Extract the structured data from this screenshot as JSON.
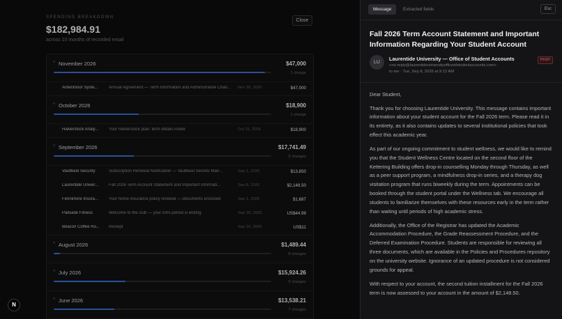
{
  "breakdown": {
    "eyebrow": "SPENDING BREAKDOWN",
    "total": "$182,984.91",
    "subtitle": "across 10 months of recorded email",
    "close_label": "Close",
    "months": [
      {
        "label": "November 2026",
        "amount": "$47,000",
        "count": "1 charge",
        "fill_pct": 97,
        "rows": [
          {
            "vendor": "Ardenmoor Syste...",
            "subject": "Annual Agreement — Term Information and Administrative Chan...",
            "date": "Nov 30, 2026",
            "amount": "$47,000"
          }
        ]
      },
      {
        "label": "October 2026",
        "amount": "$18,900",
        "count": "1 charge",
        "fill_pct": 39,
        "rows": [
          {
            "vendor": "Halverstock Analy...",
            "subject": "Your Halverstock plan: term details inside",
            "date": "Oct 31, 2026",
            "amount": "$18,900"
          }
        ]
      },
      {
        "label": "September 2026",
        "amount": "$17,741.49",
        "count": "5 charges",
        "fill_pct": 37,
        "rows": [
          {
            "vendor": "Vaultkeel Security",
            "subject": "Subscription Renewal Notification — Vaultkeel Secrets Man...",
            "date": "Sep 1, 2026",
            "amount": "$13,850"
          },
          {
            "vendor": "Laurentide Univer...",
            "subject": "Fall 2026 Term Account Statement and Important Informati...",
            "date": "Sep 8, 2026",
            "amount": "$2,148.50"
          },
          {
            "vendor": "Fennimore Insura...",
            "subject": "Your home insurance policy renewal — documents enclosed",
            "date": "Sep 1, 2026",
            "amount": "$1,687"
          },
          {
            "vendor": "Palisade Fitness",
            "subject": "Welcome to the club — your intro period is ending",
            "date": "Sep 30, 2026",
            "amount": "US$44.99"
          },
          {
            "vendor": "Beacon Coffee Ro...",
            "subject": "Receipt",
            "date": "Sep 16, 2026",
            "amount": "US$11"
          }
        ]
      },
      {
        "label": "August 2026",
        "amount": "$1,489.44",
        "count": "8 charges",
        "fill_pct": 3,
        "rows": []
      },
      {
        "label": "July 2026",
        "amount": "$15,924.26",
        "count": "5 charges",
        "fill_pct": 33,
        "rows": []
      },
      {
        "label": "June 2026",
        "amount": "$13,538.21",
        "count": "7 charges",
        "fill_pct": 28,
        "rows": []
      }
    ]
  },
  "email": {
    "tabs": [
      "Message",
      "Extracted fields"
    ],
    "esc_label": "Esc",
    "subject": "Fall 2026 Term Account Statement and Important Information Regarding Your Student Account",
    "avatar_initials": "LU",
    "sender_name": "Laurentide University — Office of Student Accounts",
    "sender_email": "<no-reply@laurentideuniversityofficeofstudentaccounts.com>",
    "meta": "to me · Tue, Sep 8, 2026 at 9:12 AM",
    "priority": "HIGH",
    "paragraphs": [
      "Dear Student,",
      "Thank you for choosing Laurentide University. This message contains important information about your student account for the Fall 2026 term. Please read it in its entirety, as it also contains updates to several institutional policies that took effect this academic year.",
      "As part of our ongoing commitment to student wellness, we would like to remind you that the Student Wellness Centre located on the second floor of the Kettering Building offers drop-in counselling Monday through Thursday, as well as a peer support program, a mindfulness drop-in series, and a therapy dog visitation program that runs biweekly during the term. Appointments can be booked through the student portal under the Wellness tab. We encourage all students to familiarize themselves with these resources early in the term rather than waiting until periods of high academic stress.",
      "Additionally, the Office of the Registrar has updated the Academic Accommodation Procedure, the Grade Reassessment Procedure, and the Deferred Examination Procedure. Students are responsible for reviewing all three documents, which are available in the Policies and Procedures repository on the university website. Ignorance of an updated procedure is not considered grounds for appeal.",
      "With respect to your account, the second tuition installment for the Fall 2026 term is now assessed to your account in the amount of $2,148.50."
    ]
  },
  "app_logo": "N"
}
